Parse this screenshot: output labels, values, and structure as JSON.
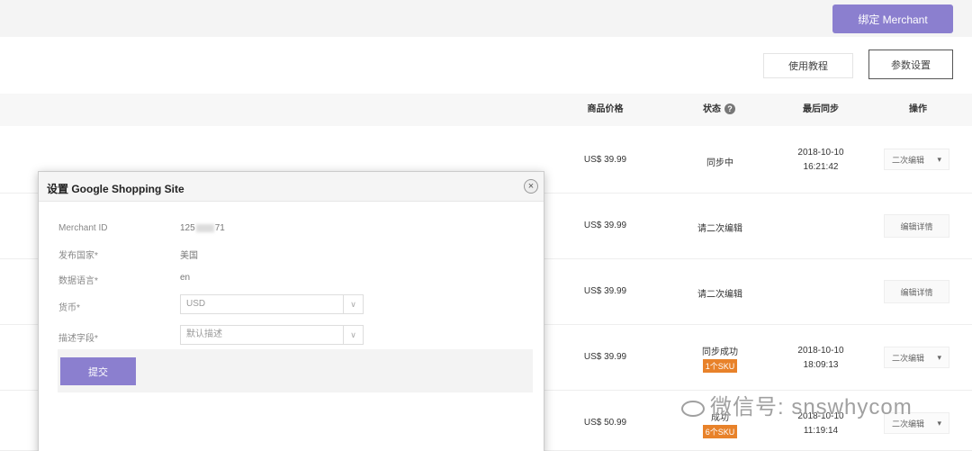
{
  "header": {
    "bind_button": "绑定 Merchant"
  },
  "toolbar": {
    "tutorial": "使用教程",
    "params": "参数设置"
  },
  "table": {
    "headers": {
      "price": "商品价格",
      "status": "状态",
      "last_sync": "最后同步",
      "ops": "操作"
    },
    "rows": [
      {
        "price": "US$ 39.99",
        "status": "同步中",
        "badge": "",
        "sync_date": "2018-10-10",
        "sync_time": "16:21:42",
        "op": "二次编辑"
      },
      {
        "price": "US$ 39.99",
        "status": "请二次编辑",
        "badge": "",
        "sync_date": "",
        "sync_time": "",
        "op": "编辑详情"
      },
      {
        "price": "US$ 39.99",
        "status": "请二次编辑",
        "badge": "",
        "sync_date": "",
        "sync_time": "",
        "op": "编辑详情"
      },
      {
        "price": "US$ 39.99",
        "status": "同步成功",
        "badge": "1个SKU",
        "sync_date": "2018-10-10",
        "sync_time": "18:09:13",
        "op": "二次编辑"
      },
      {
        "price": "US$ 50.99",
        "status": "成功",
        "badge": "6个SKU",
        "sync_date": "2018-10-10",
        "sync_time": "11:19:14",
        "op": "二次编辑"
      }
    ]
  },
  "modal": {
    "title": "设置 Google Shopping Site",
    "close": "×",
    "fields": {
      "merchant_label": "Merchant ID",
      "merchant_prefix": "125",
      "merchant_suffix": "71",
      "country_label": "发布国家*",
      "country_value": "美国",
      "language_label": "数据语言*",
      "language_value": "en",
      "currency_label": "货币*",
      "currency_value": "USD",
      "desc_label": "描述字段*",
      "desc_value": "默认描述"
    },
    "submit": "提交"
  },
  "watermark": {
    "text": "微信号: snswhycom"
  }
}
